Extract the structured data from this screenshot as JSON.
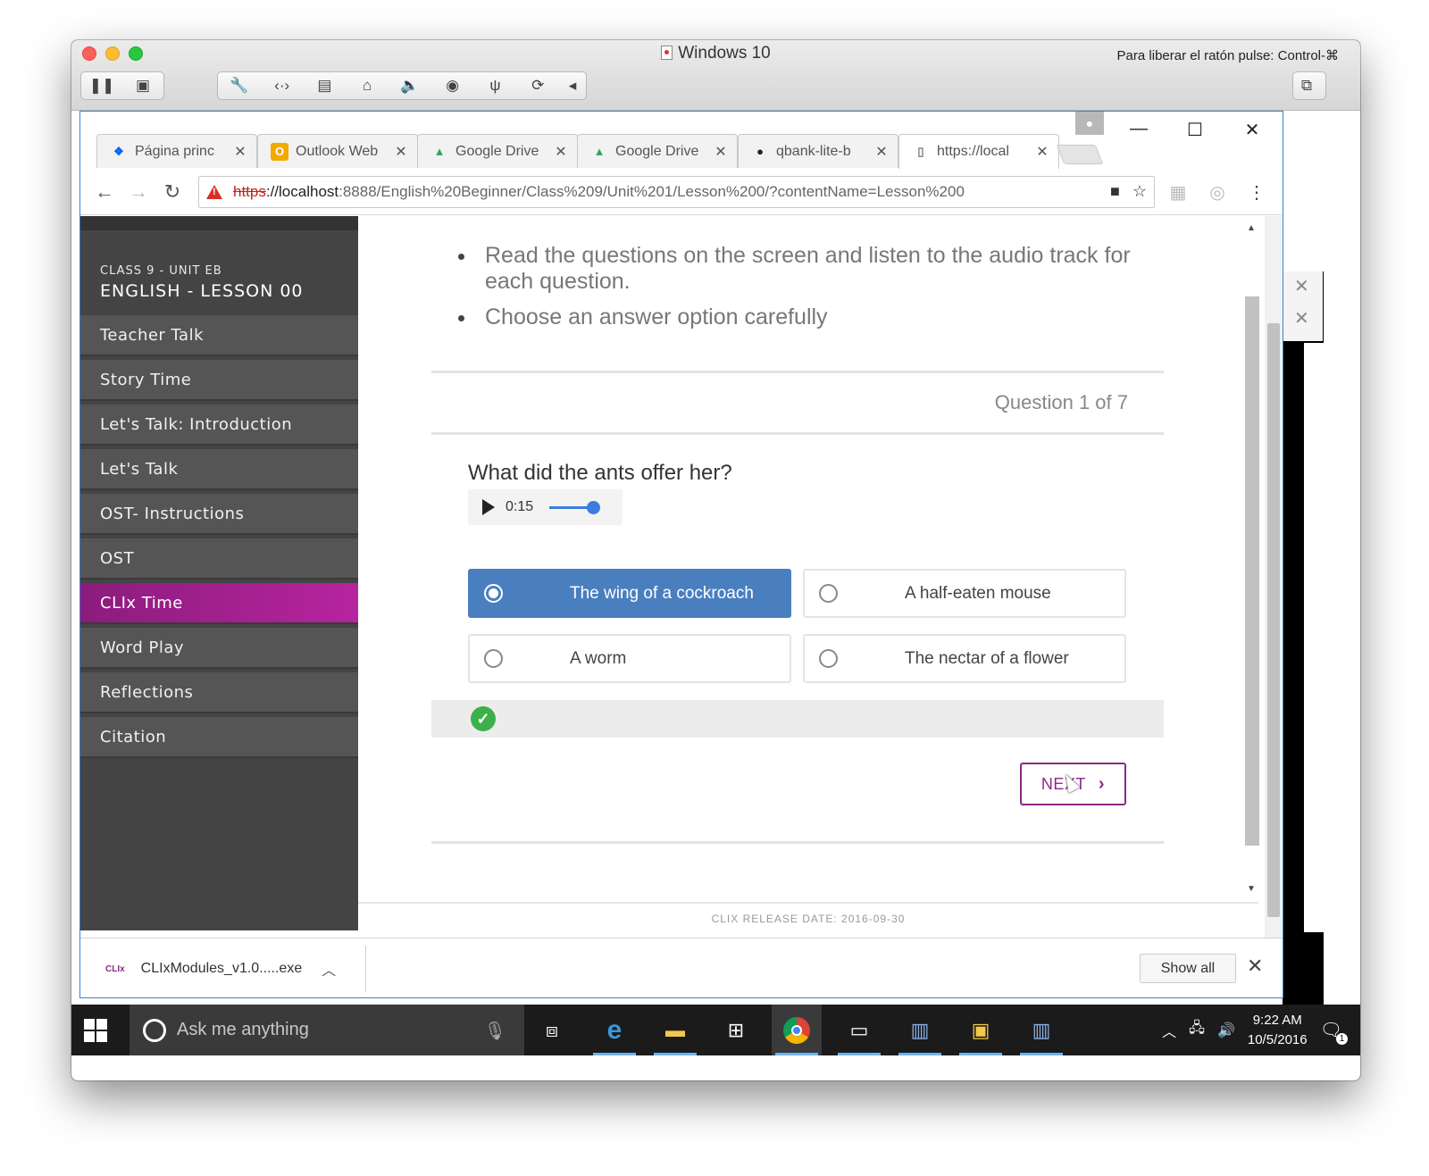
{
  "vm": {
    "title": "Windows 10",
    "hint": "Para liberar el ratón pulse: Control-⌘"
  },
  "browser": {
    "tabs": [
      {
        "label": "Página princ",
        "icon": "dropbox-icon",
        "color": "#0061fe"
      },
      {
        "label": "Outlook Web",
        "icon": "outlook-icon",
        "color": "#f2a900"
      },
      {
        "label": "Google Drive",
        "icon": "google-drive-icon",
        "color": "#34a853"
      },
      {
        "label": "Google Drive",
        "icon": "google-drive-icon",
        "color": "#34a853"
      },
      {
        "label": "qbank-lite-b",
        "icon": "github-icon",
        "color": "#222222"
      },
      {
        "label": "https://local",
        "icon": "page-icon",
        "color": "#777777"
      }
    ],
    "url": {
      "scheme": "https",
      "host": "://localhost",
      "rest": ":8888/English%20Beginner/Class%209/Unit%201/Lesson%200/?contentName=Lesson%200"
    }
  },
  "sidebar": {
    "subtitle": "CLASS 9 - UNIT EB",
    "title": "ENGLISH - LESSON 00",
    "items": [
      {
        "label": "Teacher Talk",
        "active": false
      },
      {
        "label": "Story Time",
        "active": false
      },
      {
        "label": "Let's Talk: Introduction",
        "active": false
      },
      {
        "label": "Let's Talk",
        "active": false
      },
      {
        "label": "OST- Instructions",
        "active": false
      },
      {
        "label": "OST",
        "active": false
      },
      {
        "label": "CLIx Time",
        "active": true
      },
      {
        "label": "Word Play",
        "active": false
      },
      {
        "label": "Reflections",
        "active": false
      },
      {
        "label": "Citation",
        "active": false
      }
    ]
  },
  "main": {
    "instructions": [
      "Read the questions on the screen and listen to the audio track for each question.",
      "Choose an answer option carefully"
    ],
    "counter": "Question 1 of 7",
    "question": "What did the ants offer her?",
    "audio": {
      "time": "0:15",
      "progress": 1.0
    },
    "options": [
      {
        "label": "The wing of a cockroach",
        "selected": true
      },
      {
        "label": "A half-eaten mouse",
        "selected": false
      },
      {
        "label": "A worm",
        "selected": false
      },
      {
        "label": "The nectar of a flower",
        "selected": false
      }
    ],
    "feedback": "correct",
    "next_label": "NEXT",
    "footer": "CLIX RELEASE DATE: 2016-09-30"
  },
  "downloads": {
    "logo": "CLIx",
    "file": "CLIxModules_v1.0.....exe",
    "show_all": "Show all"
  },
  "taskbar": {
    "search_placeholder": "Ask me anything",
    "time": "9:22 AM",
    "date": "10/5/2016",
    "notification_count": "1"
  },
  "colors": {
    "accent": "#8a2a86",
    "selected_option": "#4a7fbf",
    "sidebar": "#444444",
    "check": "#3cb14a"
  }
}
